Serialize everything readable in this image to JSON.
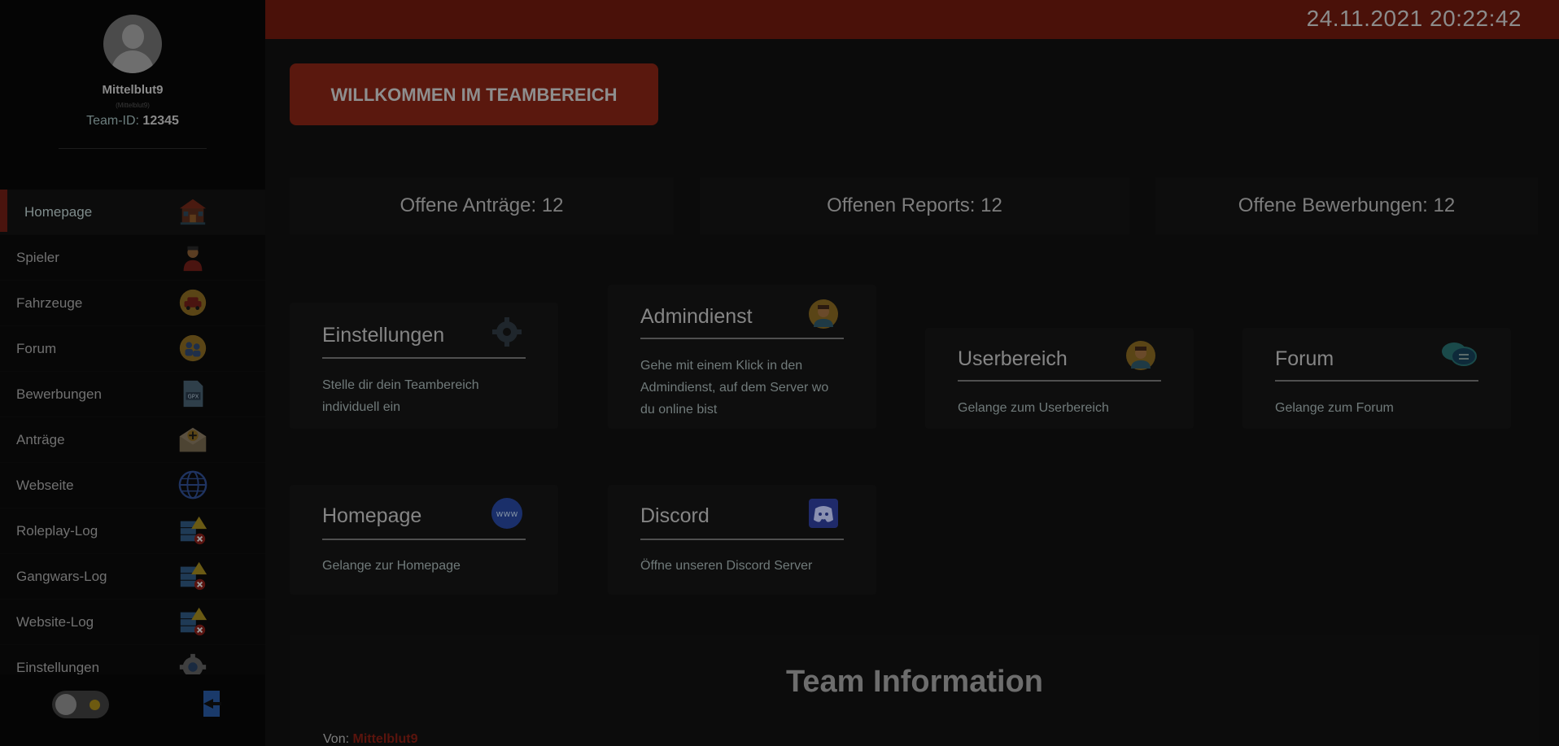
{
  "sidebar": {
    "username": "Mittelblut9",
    "username_sub": "(Mittelblut9)",
    "team_id_label": "Team-ID:",
    "team_id_value": "12345",
    "items": [
      {
        "label": "Homepage",
        "icon": "house-icon"
      },
      {
        "label": "Spieler",
        "icon": "player-icon"
      },
      {
        "label": "Fahrzeuge",
        "icon": "car-icon"
      },
      {
        "label": "Forum",
        "icon": "forum-icon"
      },
      {
        "label": "Bewerbungen",
        "icon": "gpx-file-icon"
      },
      {
        "label": "Anträge",
        "icon": "envelope-plus-icon"
      },
      {
        "label": "Webseite",
        "icon": "globe-icon"
      },
      {
        "label": "Roleplay-Log",
        "icon": "log-warning-icon"
      },
      {
        "label": "Gangwars-Log",
        "icon": "log-warning-icon"
      },
      {
        "label": "Website-Log",
        "icon": "log-warning-icon"
      },
      {
        "label": "Einstellungen",
        "icon": "gear-icon"
      }
    ],
    "active_item": "Homepage"
  },
  "header": {
    "datetime": "24.11.2021 20:22:42"
  },
  "welcome": {
    "label": "WILLKOMMEN IM TEAMBEREICH"
  },
  "stats": [
    {
      "label": "Offene Anträge: 12"
    },
    {
      "label": "Offenen Reports: 12"
    },
    {
      "label": "Offene Bewerbungen: 12"
    }
  ],
  "cards": {
    "einstellungen": {
      "title": "Einstellungen",
      "text": "Stelle dir dein Teambereich individuell ein",
      "icon": "gear-icon"
    },
    "admindienst": {
      "title": "Admindienst",
      "text": "Gehe mit einem Klick in den Admindienst, auf dem Server wo du online bist",
      "icon": "admin-avatar-icon"
    },
    "userbereich": {
      "title": "Userbereich",
      "text": "Gelange zum Userbereich",
      "icon": "user-avatar-icon"
    },
    "forum": {
      "title": "Forum",
      "text": "Gelange zum Forum",
      "icon": "chat-bubbles-icon"
    },
    "homepage": {
      "title": "Homepage",
      "text": "Gelange zur Homepage",
      "icon": "www-icon"
    },
    "discord": {
      "title": "Discord",
      "text": "Öffne unseren Discord Server",
      "icon": "discord-icon"
    }
  },
  "team_info": {
    "title": "Team Information",
    "from_label": "Von:",
    "from_value": "Mittelblut9"
  },
  "colors": {
    "accent": "#4a1109",
    "button": "#5a180e",
    "background": "#0b0b0b"
  }
}
